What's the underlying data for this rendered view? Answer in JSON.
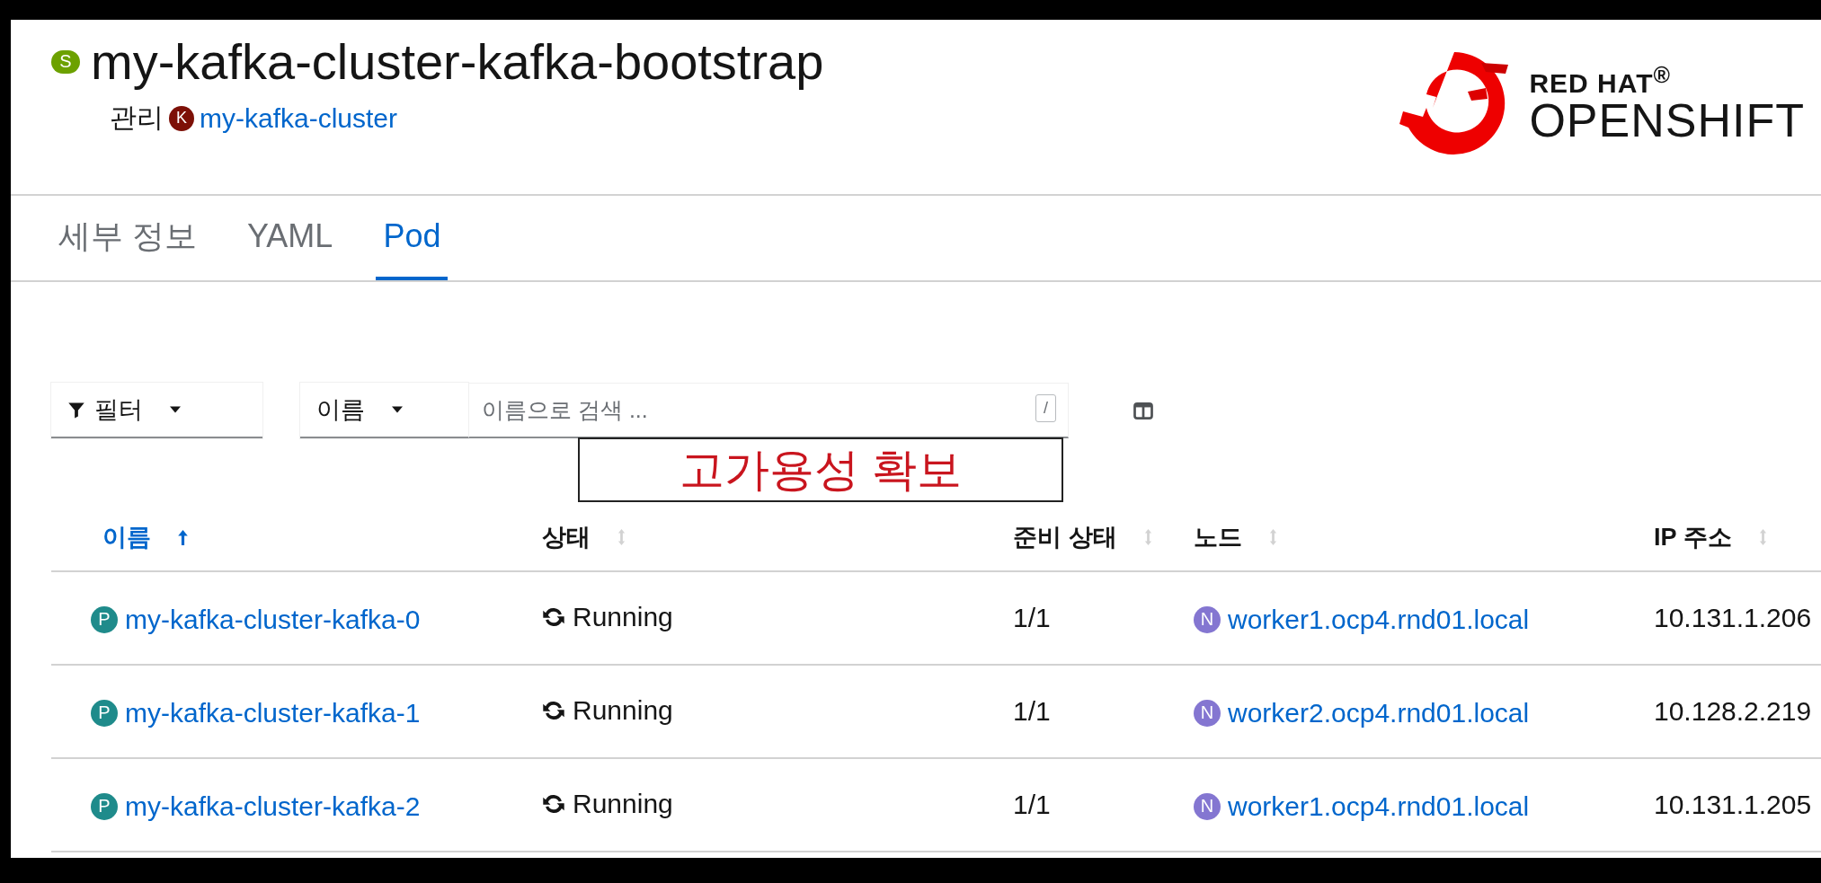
{
  "header": {
    "badge": {
      "letter": "S",
      "color": "#6ca100"
    },
    "title": "my-kafka-cluster-kafka-bootstrap",
    "owner_label": "관리",
    "owner_badge": {
      "letter": "K",
      "color": "#7d1007"
    },
    "owner_link": "my-kafka-cluster"
  },
  "logo": {
    "line1": "RED HAT$^{®}$",
    "line2": "OPENSHIFT"
  },
  "tabs": [
    {
      "label": "세부 정보",
      "selected": false
    },
    {
      "label": "YAML",
      "selected": false
    },
    {
      "label": "Pod",
      "selected": true
    }
  ],
  "toolbar": {
    "filter": "필터",
    "attribute": "이름",
    "search": {
      "placeholder": "이름으로 검색 ...",
      "shortcut": "/"
    }
  },
  "annotation": "고가용성 확보",
  "table": {
    "columns": [
      {
        "label": "이름",
        "sorted": true
      },
      {
        "label": "상태",
        "sorted": false
      },
      {
        "label": "준비 상태",
        "sorted": false
      },
      {
        "label": "노드",
        "sorted": false
      },
      {
        "label": "IP 주소",
        "sorted": false
      }
    ],
    "rows": [
      {
        "pod_badge": {
          "letter": "P",
          "color": "#1f8b8b"
        },
        "name": "my-kafka-cluster-kafka-0",
        "status": "Running",
        "ready": "1/1",
        "node_badge": {
          "letter": "N",
          "color": "#8476d1"
        },
        "node": "worker1.ocp4.rnd01.local",
        "ip": "10.131.1.206"
      },
      {
        "pod_badge": {
          "letter": "P",
          "color": "#1f8b8b"
        },
        "name": "my-kafka-cluster-kafka-1",
        "status": "Running",
        "ready": "1/1",
        "node_badge": {
          "letter": "N",
          "color": "#8476d1"
        },
        "node": "worker2.ocp4.rnd01.local",
        "ip": "10.128.2.219"
      },
      {
        "pod_badge": {
          "letter": "P",
          "color": "#1f8b8b"
        },
        "name": "my-kafka-cluster-kafka-2",
        "status": "Running",
        "ready": "1/1",
        "node_badge": {
          "letter": "N",
          "color": "#8476d1"
        },
        "node": "worker1.ocp4.rnd01.local",
        "ip": "10.131.1.205"
      }
    ]
  }
}
